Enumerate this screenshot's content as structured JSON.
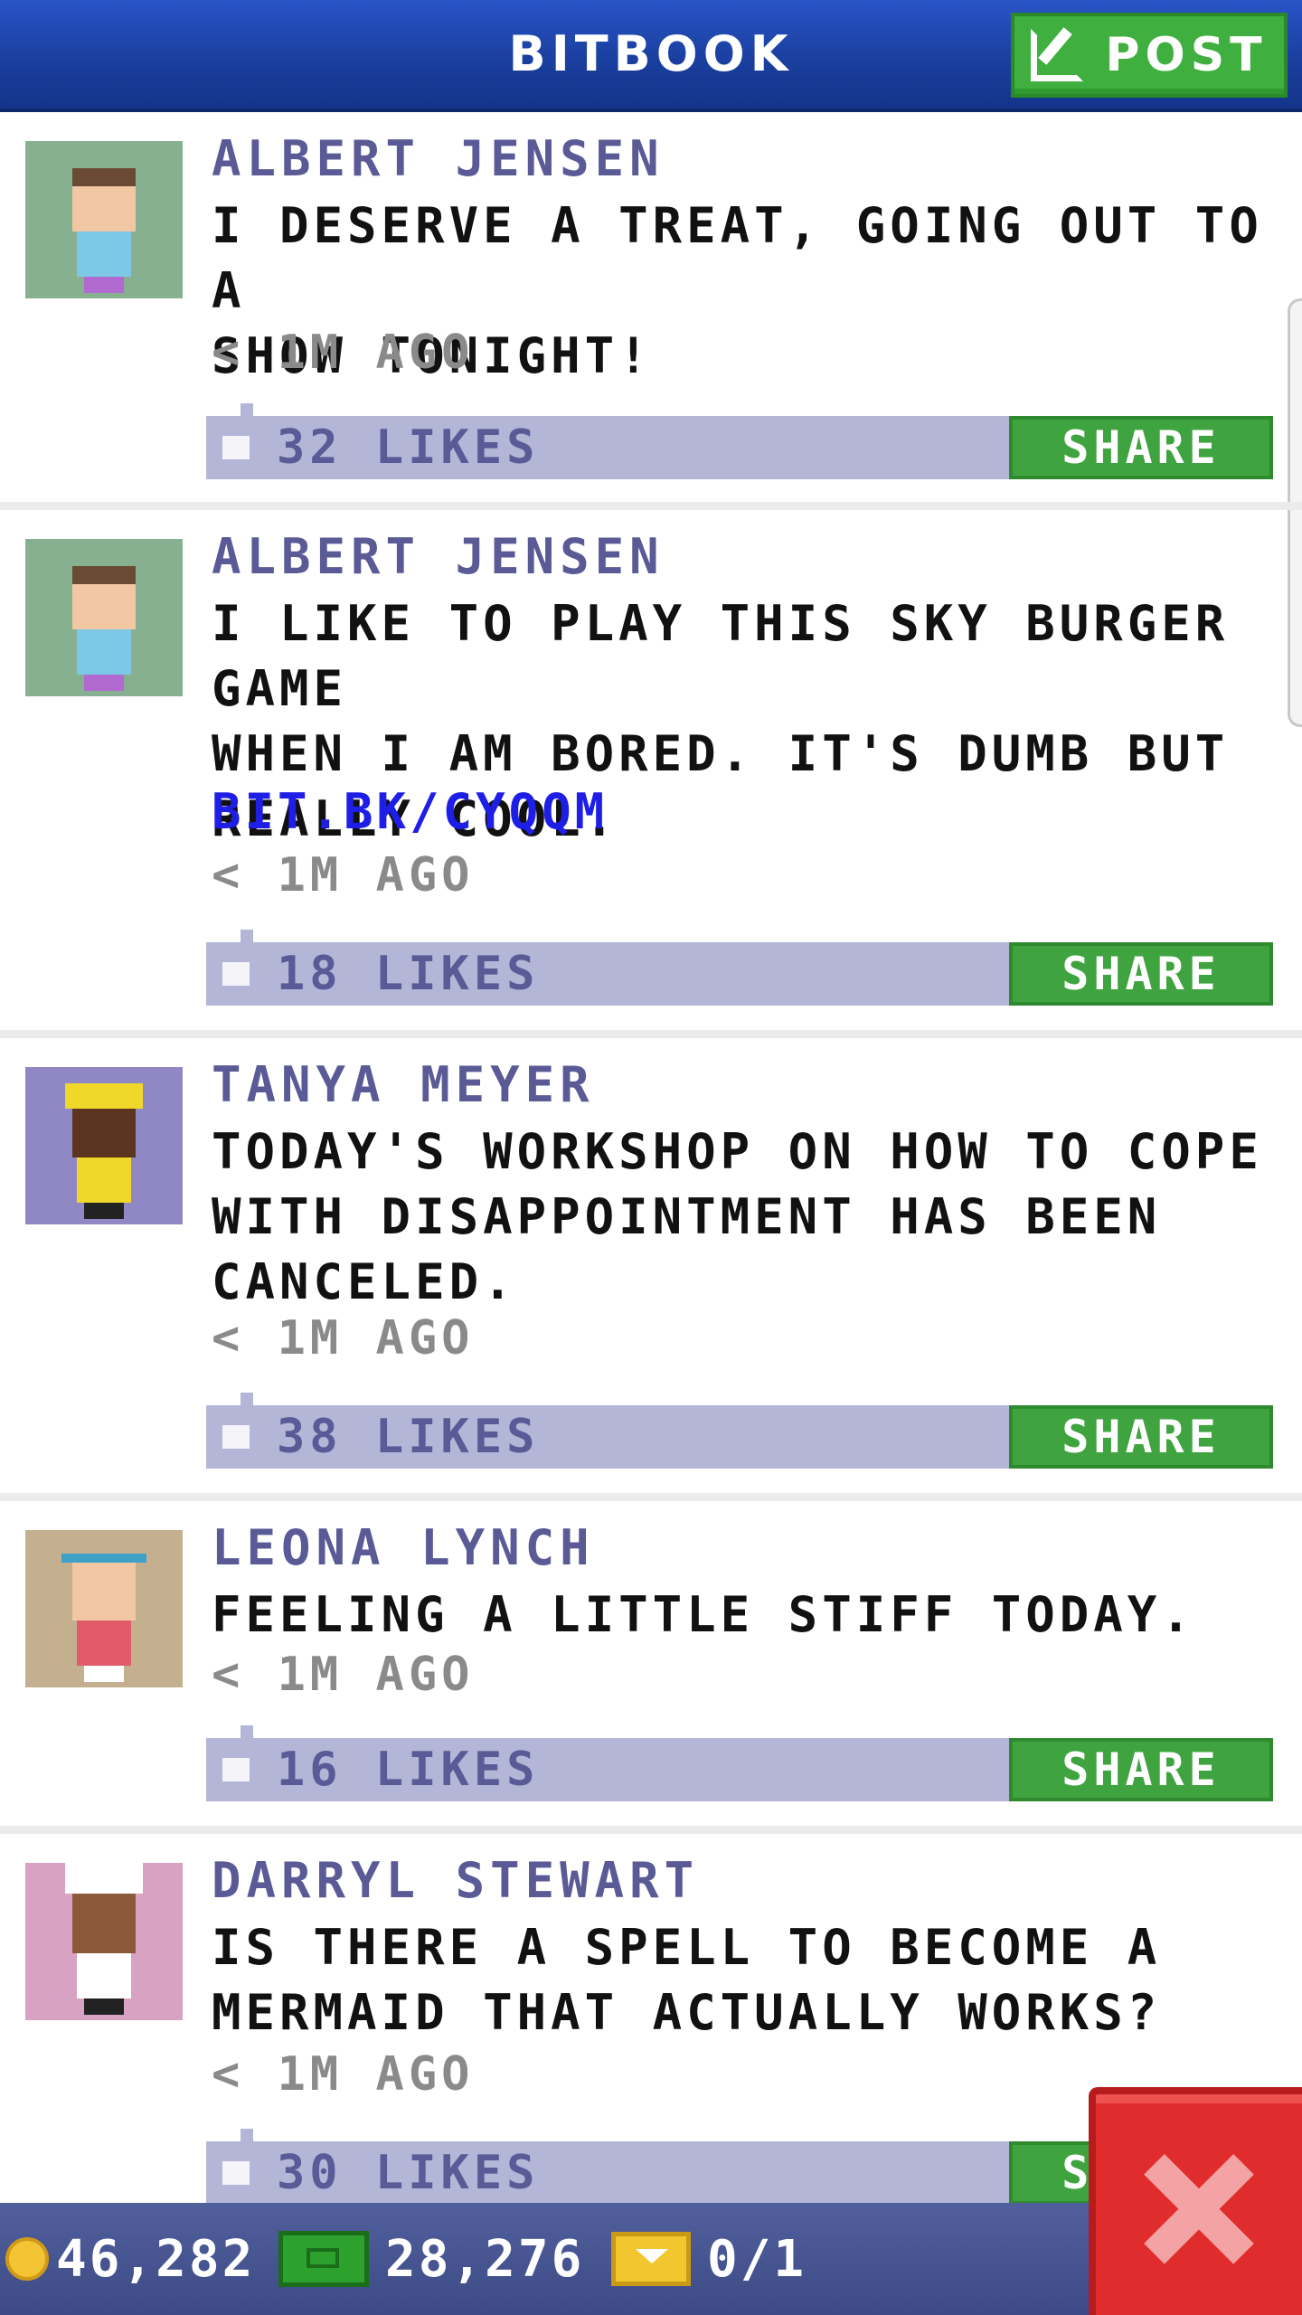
{
  "header": {
    "title": "BITBOOK",
    "post_label": "POST"
  },
  "posts": [
    {
      "author": "ALBERT JENSEN",
      "lines": [
        "I DESERVE A TREAT, GOING OUT TO A",
        "SHOW TONIGHT!"
      ],
      "link": "",
      "time": "< 1M AGO",
      "likes": "32 LIKES",
      "share_label": "SHARE",
      "avatar_bg": "#86b090"
    },
    {
      "author": "ALBERT JENSEN",
      "lines": [
        "I LIKE TO PLAY THIS SKY BURGER GAME",
        "WHEN I AM BORED. IT'S DUMB BUT",
        "REALLY COOL."
      ],
      "link": "BIT.BK/CYQQM",
      "time": "< 1M AGO",
      "likes": "18 LIKES",
      "share_label": "SHARE",
      "avatar_bg": "#86b090"
    },
    {
      "author": "TANYA MEYER",
      "lines": [
        "TODAY'S WORKSHOP ON HOW TO COPE",
        "WITH DISAPPOINTMENT HAS BEEN",
        "CANCELED."
      ],
      "link": "",
      "time": "< 1M AGO",
      "likes": "38 LIKES",
      "share_label": "SHARE",
      "avatar_bg": "#9088c4"
    },
    {
      "author": "LEONA LYNCH",
      "lines": [
        "FEELING A LITTLE STIFF TODAY."
      ],
      "link": "",
      "time": "< 1M AGO",
      "likes": "16 LIKES",
      "share_label": "SHARE",
      "avatar_bg": "#c4b08e"
    },
    {
      "author": "DARRYL STEWART",
      "lines": [
        "IS THERE A SPELL TO BECOME A",
        "MERMAID THAT ACTUALLY WORKS?"
      ],
      "link": "",
      "time": "< 1M AGO",
      "likes": "30 LIKES",
      "share_label": "SHARE",
      "avatar_bg": "#d8a2c2"
    }
  ],
  "status": {
    "coins": "46,282",
    "bux": "28,276",
    "tickets": "0/1"
  },
  "icons": {
    "post": "edit-icon",
    "like": "like-icon",
    "coin": "coin-icon",
    "bux": "bux-icon",
    "ticket": "ticket-icon",
    "close": "close-icon"
  }
}
